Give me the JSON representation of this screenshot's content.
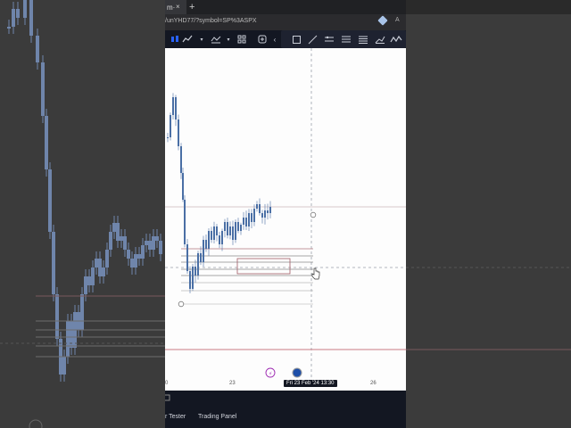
{
  "browser": {
    "tab_title": "m·",
    "tab_close": "×",
    "new_tab": "+",
    "url": "/unYHD77/?symbol=SP%3ASPX",
    "font_glyph": "A"
  },
  "axis": {
    "ticks": [
      "0",
      "23",
      "26"
    ],
    "crosshair_label": "Fri 23 Feb '24   13:30"
  },
  "bottom": {
    "tester_label": "r Tester",
    "panel_label": "Trading Panel"
  },
  "colors": {
    "candle": "#4a6fa5",
    "level_red": "#c97b84",
    "level_dark": "#444444",
    "toolbar_bg": "#131722",
    "page_bg": "#3a3a3a"
  },
  "icons": [
    "candles-icon",
    "line-tool-icon",
    "indicators-icon",
    "layout-icon",
    "alert-icon",
    "cursor-icon",
    "rectangle-icon",
    "trendline-icon",
    "channel-icon",
    "fib-icon",
    "hlines-icon",
    "brush-icon",
    "pattern-icon"
  ]
}
